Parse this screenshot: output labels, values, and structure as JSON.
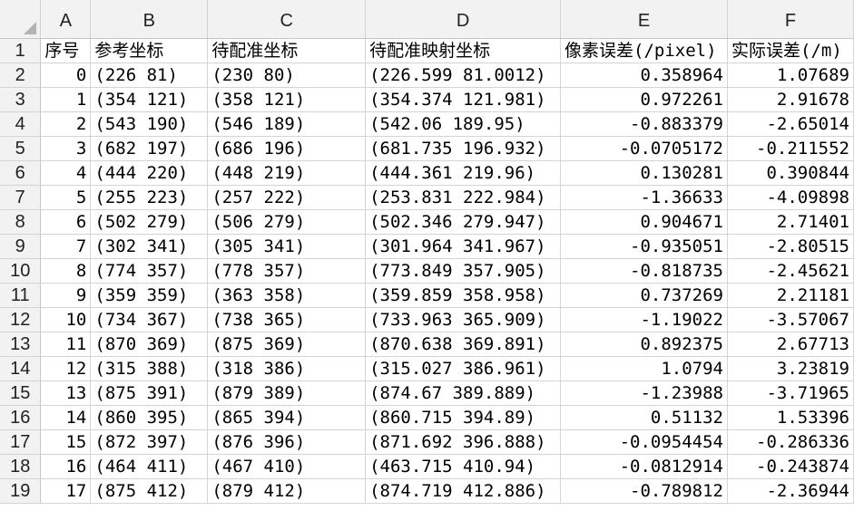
{
  "sheet": {
    "column_letters": [
      "A",
      "B",
      "C",
      "D",
      "E",
      "F"
    ],
    "row_numbers": [
      "1",
      "2",
      "3",
      "4",
      "5",
      "6",
      "7",
      "8",
      "9",
      "10",
      "11",
      "12",
      "13",
      "14",
      "15",
      "16",
      "17",
      "18",
      "19"
    ],
    "headers": [
      "序号",
      "参考坐标",
      "待配准坐标",
      "待配准映射坐标",
      "像素误差(/pixel)",
      "实际误差(/m)"
    ],
    "rows": [
      [
        "0",
        "(226 81)",
        "(230 80)",
        "(226.599 81.0012)",
        "0.358964",
        "1.07689"
      ],
      [
        "1",
        "(354 121)",
        "(358 121)",
        "(354.374 121.981)",
        "0.972261",
        "2.91678"
      ],
      [
        "2",
        "(543 190)",
        "(546 189)",
        "(542.06 189.95)",
        "-0.883379",
        "-2.65014"
      ],
      [
        "3",
        "(682 197)",
        "(686 196)",
        "(681.735 196.932)",
        "-0.0705172",
        "-0.211552"
      ],
      [
        "4",
        "(444 220)",
        "(448 219)",
        "(444.361 219.96)",
        "0.130281",
        "0.390844"
      ],
      [
        "5",
        "(255 223)",
        "(257 222)",
        "(253.831 222.984)",
        "-1.36633",
        "-4.09898"
      ],
      [
        "6",
        "(502 279)",
        "(506 279)",
        "(502.346 279.947)",
        "0.904671",
        "2.71401"
      ],
      [
        "7",
        "(302 341)",
        "(305 341)",
        "(301.964 341.967)",
        "-0.935051",
        "-2.80515"
      ],
      [
        "8",
        "(774 357)",
        "(778 357)",
        "(773.849 357.905)",
        "-0.818735",
        "-2.45621"
      ],
      [
        "9",
        "(359 359)",
        "(363 358)",
        "(359.859 358.958)",
        "0.737269",
        "2.21181"
      ],
      [
        "10",
        "(734 367)",
        "(738 365)",
        "(733.963 365.909)",
        "-1.19022",
        "-3.57067"
      ],
      [
        "11",
        "(870 369)",
        "(875 369)",
        "(870.638 369.891)",
        "0.892375",
        "2.67713"
      ],
      [
        "12",
        "(315 388)",
        "(318 386)",
        "(315.027 386.961)",
        "1.0794",
        "3.23819"
      ],
      [
        "13",
        "(875 391)",
        "(879 389)",
        "(874.67 389.889)",
        "-1.23988",
        "-3.71965"
      ],
      [
        "14",
        "(860 395)",
        "(865 394)",
        "(860.715 394.89)",
        "0.51132",
        "1.53396"
      ],
      [
        "15",
        "(872 397)",
        "(876 396)",
        "(871.692 396.888)",
        "-0.0954454",
        "-0.286336"
      ],
      [
        "16",
        "(464 411)",
        "(467 410)",
        "(463.715 410.94)",
        "-0.0812914",
        "-0.243874"
      ],
      [
        "17",
        "(875 412)",
        "(879 412)",
        "(874.719 412.886)",
        "-0.789812",
        "-2.36944"
      ]
    ]
  }
}
